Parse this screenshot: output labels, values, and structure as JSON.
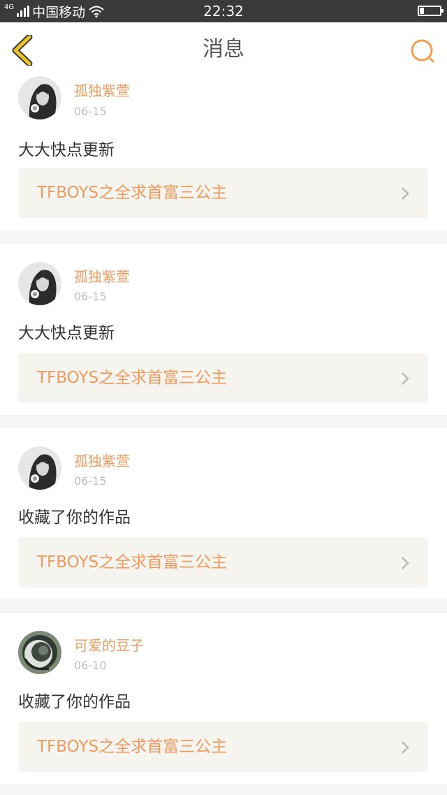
{
  "status_bar": {
    "network_type": "4G",
    "carrier": "中国移动",
    "time": "22:32",
    "battery_level": 0.2,
    "icons": [
      "signal-icon",
      "wifi-icon",
      "battery-icon"
    ]
  },
  "nav": {
    "title": "消息",
    "back_icon": "chevron-left-icon",
    "search_icon": "search-icon",
    "accent_color": "#f0a050",
    "back_color": "#e8c428"
  },
  "notifications": [
    {
      "username": "孤独紫萱",
      "date": "06-15",
      "message": "大大快点更新",
      "work_title": "TFBOYS之全求首富三公主"
    },
    {
      "username": "孤独紫萱",
      "date": "06-15",
      "message": "大大快点更新",
      "work_title": "TFBOYS之全求首富三公主"
    },
    {
      "username": "孤独紫萱",
      "date": "06-15",
      "message": "收藏了你的作品",
      "work_title": "TFBOYS之全求首富三公主"
    },
    {
      "username": "可爱的豆子",
      "date": "06-10",
      "message": "收藏了你的作品",
      "work_title": "TFBOYS之全求首富三公主"
    }
  ],
  "colors": {
    "name_accent": "#ef9a5f",
    "date_grey": "#bdbdbd",
    "link_bg": "#f5f4ef"
  }
}
